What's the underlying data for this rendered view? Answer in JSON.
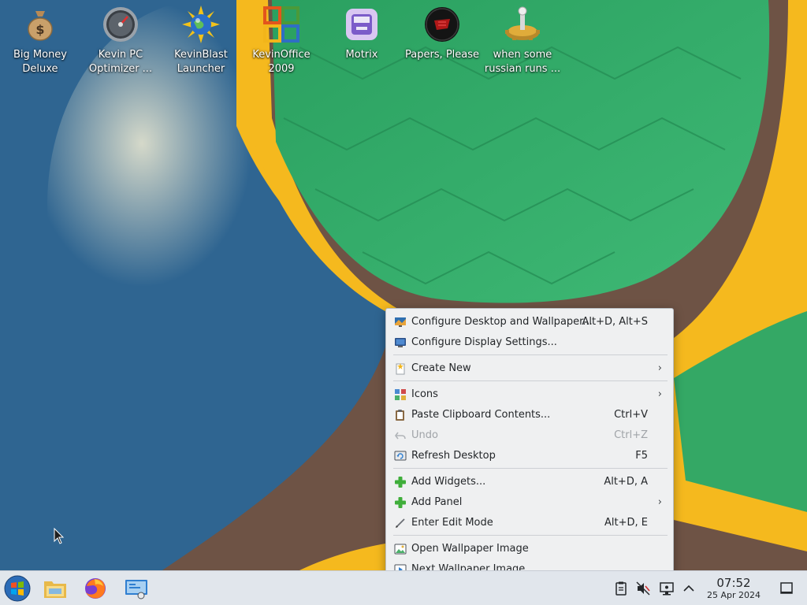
{
  "desktop_icons": [
    {
      "label": "Big Money\nDeluxe",
      "icon": "money-bag-icon"
    },
    {
      "label": "Kevin PC\nOptimizer ...",
      "icon": "speedometer-icon"
    },
    {
      "label": "KevinBlast\nLauncher",
      "icon": "sun-globe-icon"
    },
    {
      "label": "KevinOffice\n2009",
      "icon": "office-logo-icon"
    },
    {
      "label": "Motrix",
      "icon": "motrix-icon"
    },
    {
      "label": "Papers, Please",
      "icon": "papers-please-icon"
    },
    {
      "label": "when some\nrussian runs ...",
      "icon": "joystick-gear-icon"
    }
  ],
  "context_menu": {
    "items": [
      {
        "label": "Configure Desktop and Wallpaper...",
        "shortcut": "Alt+D, Alt+S",
        "icon": "configure-desktop-icon"
      },
      {
        "label": "Configure Display Settings...",
        "shortcut": "",
        "icon": "display-settings-icon"
      },
      {
        "label": "Create New",
        "shortcut": "",
        "submenu": true,
        "icon": "create-new-icon"
      },
      {
        "label": "Icons",
        "shortcut": "",
        "submenu": true,
        "icon": "icons-grid-icon"
      },
      {
        "label": "Paste Clipboard Contents...",
        "shortcut": "Ctrl+V",
        "icon": "paste-icon"
      },
      {
        "label": "Undo",
        "shortcut": "Ctrl+Z",
        "disabled": true,
        "icon": "undo-icon"
      },
      {
        "label": "Refresh Desktop",
        "shortcut": "F5",
        "icon": "refresh-icon"
      },
      {
        "label": "Add Widgets...",
        "shortcut": "Alt+D, A",
        "icon": "add-icon"
      },
      {
        "label": "Add Panel",
        "shortcut": "",
        "submenu": true,
        "icon": "add-icon"
      },
      {
        "label": "Enter Edit Mode",
        "shortcut": "Alt+D, E",
        "icon": "edit-mode-icon"
      },
      {
        "label": "Open Wallpaper Image",
        "shortcut": "",
        "icon": "open-image-icon"
      },
      {
        "label": "Next Wallpaper Image",
        "shortcut": "",
        "icon": "next-image-icon"
      }
    ],
    "submenu_arrow": "›"
  },
  "taskbar": {
    "apps": [
      "start-orb-icon",
      "file-manager-icon",
      "firefox-icon",
      "remote-desktop-icon"
    ],
    "tray": [
      "clipboard-icon",
      "volume-muted-icon",
      "network-icon",
      "tray-expand-icon"
    ],
    "clock": {
      "time": "07:52",
      "date": "25 Apr 2024"
    },
    "show_desktop": "show-desktop-icon"
  },
  "colors": {
    "menu_bg": "#eff0f1",
    "taskbar_bg": "#e1e6ec",
    "wallpaper_green": "#2fa35f",
    "wallpaper_yellow": "#f5b91e",
    "wallpaper_brown": "#6e5345",
    "wallpaper_blue": "#2f5f8a"
  }
}
